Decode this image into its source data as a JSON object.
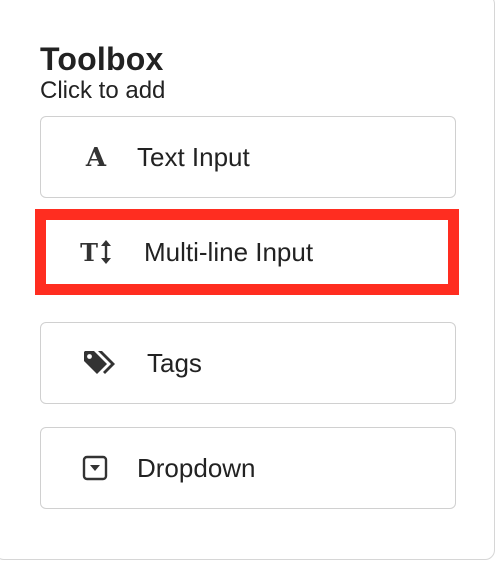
{
  "toolbox": {
    "title": "Toolbox",
    "subtitle": "Click to add",
    "items": [
      {
        "label": "Text Input",
        "icon": "text-input-icon"
      },
      {
        "label": "Multi-line Input",
        "icon": "text-height-icon",
        "highlighted": true,
        "highlight_color": "#ff2d20"
      },
      {
        "label": "Tags",
        "icon": "tags-icon"
      },
      {
        "label": "Dropdown",
        "icon": "dropdown-icon"
      }
    ]
  }
}
